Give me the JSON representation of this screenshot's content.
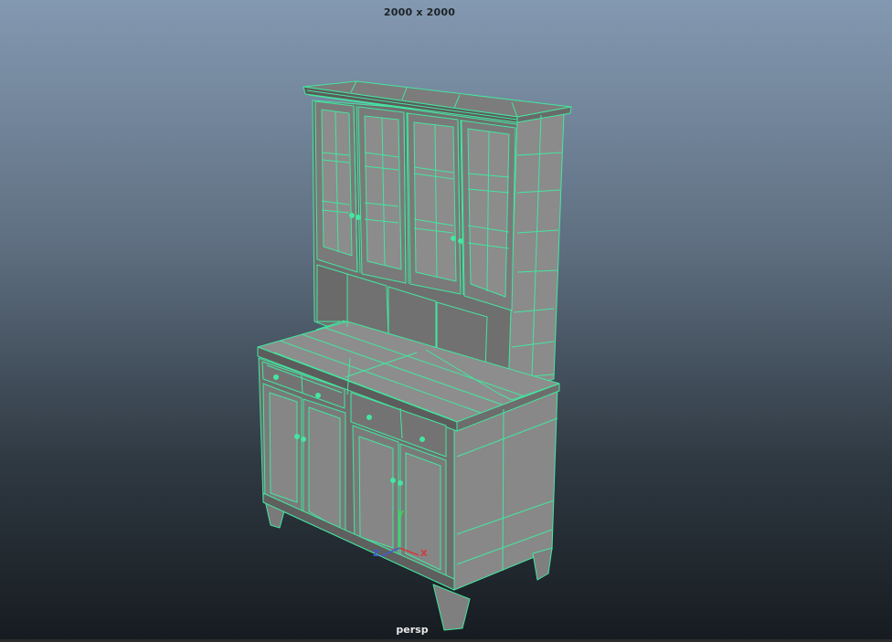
{
  "viewport": {
    "resolution_gate": "2000 x 2000",
    "camera_name": "persp",
    "background_top": "#8399b1",
    "background_bottom": "#161b20"
  },
  "model": {
    "wire_color": "#44e6a0",
    "shade_light": "#8a8a8a",
    "shade_mid": "#777777",
    "shade_dark": "#5d5d5d"
  },
  "axis_gizmo": {
    "x_label": "X",
    "y_label": "Y",
    "z_label": "Z",
    "x_color": "#d23a3a",
    "y_color": "#3fcf5a",
    "z_color": "#3a5ad8"
  }
}
